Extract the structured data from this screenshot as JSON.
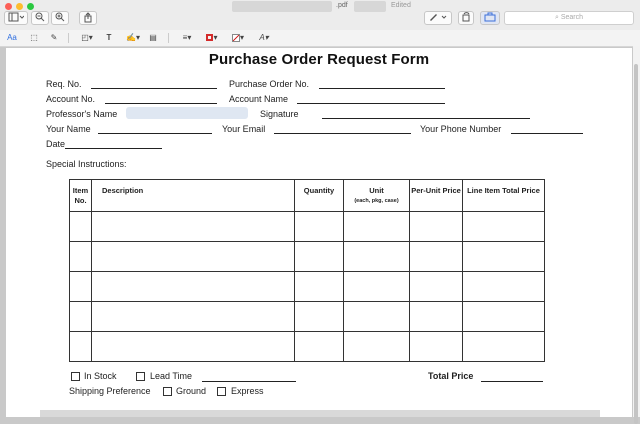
{
  "window": {
    "title_suffix": ".pdf",
    "status": "Edited",
    "search_placeholder": "Search"
  },
  "toolbar": {
    "sidebar_label": "▾",
    "markup_label": "▾"
  },
  "markup_bar": {
    "text_label": "Aa",
    "text_tool": "T"
  },
  "form": {
    "title": "Purchase Order Request Form",
    "req_no": "Req. No.",
    "po_number": "Purchase Order No.",
    "account_no": "Account No.",
    "account_name": "Account Name",
    "professor_name": "Professor's Name",
    "signature": "Signature",
    "your_name": "Your Name",
    "your_email": "Your Email",
    "your_phone": "Your Phone Number",
    "date": "Date",
    "special_instructions": "Special Instructions:",
    "table": {
      "headers": {
        "item": "Item No.",
        "description": "Description",
        "quantity": "Quantity",
        "unit": "Unit",
        "unit_sub": "(each, pkg, case)",
        "per_unit_price": "Per-Unit Price",
        "line_total": "Line Item Total Price"
      },
      "row_count": 5
    },
    "in_stock": "In Stock",
    "lead_time": "Lead Time",
    "total_price": "Total Price",
    "shipping_preference": "Shipping Preference",
    "ground": "Ground",
    "express": "Express"
  }
}
